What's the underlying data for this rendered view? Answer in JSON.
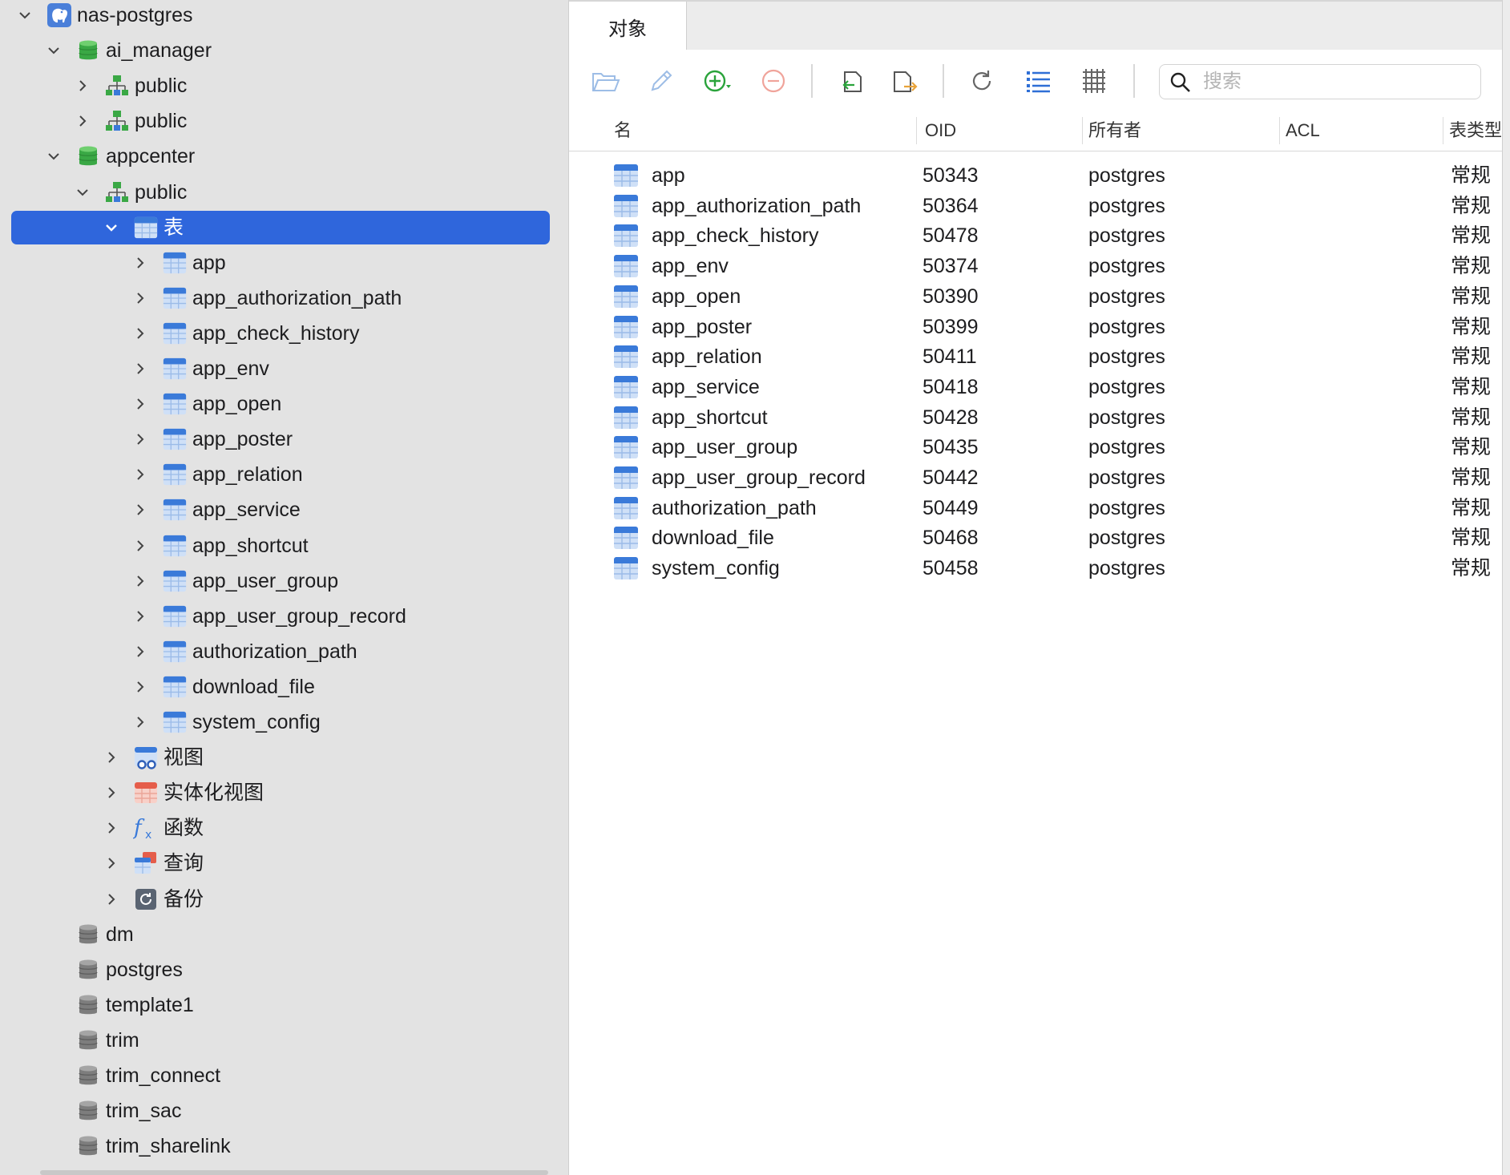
{
  "sidebar": {
    "connection": "nas-postgres",
    "db_ai_manager": "ai_manager",
    "schema_public_1": "public",
    "schema_public_2": "public",
    "db_appcenter": "appcenter",
    "schema_public_3": "public",
    "tables_group": "表",
    "tables": [
      "app",
      "app_authorization_path",
      "app_check_history",
      "app_env",
      "app_open",
      "app_poster",
      "app_relation",
      "app_service",
      "app_shortcut",
      "app_user_group",
      "app_user_group_record",
      "authorization_path",
      "download_file",
      "system_config"
    ],
    "views": "视图",
    "materialized_views": "实体化视图",
    "functions": "函数",
    "queries": "查询",
    "backups": "备份",
    "other_databases": [
      "dm",
      "postgres",
      "template1",
      "trim",
      "trim_connect",
      "trim_sac",
      "trim_sharelink"
    ]
  },
  "main": {
    "tab_label": "对象",
    "search": {
      "placeholder": "搜索",
      "value": ""
    },
    "columns": {
      "name": "名",
      "oid": "OID",
      "owner": "所有者",
      "acl": "ACL",
      "type": "表类型"
    },
    "rows": [
      {
        "name": "app",
        "oid": "50343",
        "owner": "postgres",
        "acl": "",
        "type": "常规"
      },
      {
        "name": "app_authorization_path",
        "oid": "50364",
        "owner": "postgres",
        "acl": "",
        "type": "常规"
      },
      {
        "name": "app_check_history",
        "oid": "50478",
        "owner": "postgres",
        "acl": "",
        "type": "常规"
      },
      {
        "name": "app_env",
        "oid": "50374",
        "owner": "postgres",
        "acl": "",
        "type": "常规"
      },
      {
        "name": "app_open",
        "oid": "50390",
        "owner": "postgres",
        "acl": "",
        "type": "常规"
      },
      {
        "name": "app_poster",
        "oid": "50399",
        "owner": "postgres",
        "acl": "",
        "type": "常规"
      },
      {
        "name": "app_relation",
        "oid": "50411",
        "owner": "postgres",
        "acl": "",
        "type": "常规"
      },
      {
        "name": "app_service",
        "oid": "50418",
        "owner": "postgres",
        "acl": "",
        "type": "常规"
      },
      {
        "name": "app_shortcut",
        "oid": "50428",
        "owner": "postgres",
        "acl": "",
        "type": "常规"
      },
      {
        "name": "app_user_group",
        "oid": "50435",
        "owner": "postgres",
        "acl": "",
        "type": "常规"
      },
      {
        "name": "app_user_group_record",
        "oid": "50442",
        "owner": "postgres",
        "acl": "",
        "type": "常规"
      },
      {
        "name": "authorization_path",
        "oid": "50449",
        "owner": "postgres",
        "acl": "",
        "type": "常规"
      },
      {
        "name": "download_file",
        "oid": "50468",
        "owner": "postgres",
        "acl": "",
        "type": "常规"
      },
      {
        "name": "system_config",
        "oid": "50458",
        "owner": "postgres",
        "acl": "",
        "type": "常规"
      }
    ]
  },
  "icons": {
    "connection": "elephant-icon",
    "database_open": "green-database-icon",
    "database_closed": "gray-database-icon",
    "schema": "schema-tree-icon",
    "table": "table-icon",
    "view": "view-icon",
    "materialized_view": "materialized-view-icon",
    "function": "function-icon",
    "query": "query-icon",
    "backup": "backup-icon"
  },
  "colors": {
    "selection": "#2f66dc",
    "accent_green": "#2aa33b",
    "accent_red": "#e25a4c",
    "accent_blue": "#2f6fd6"
  }
}
